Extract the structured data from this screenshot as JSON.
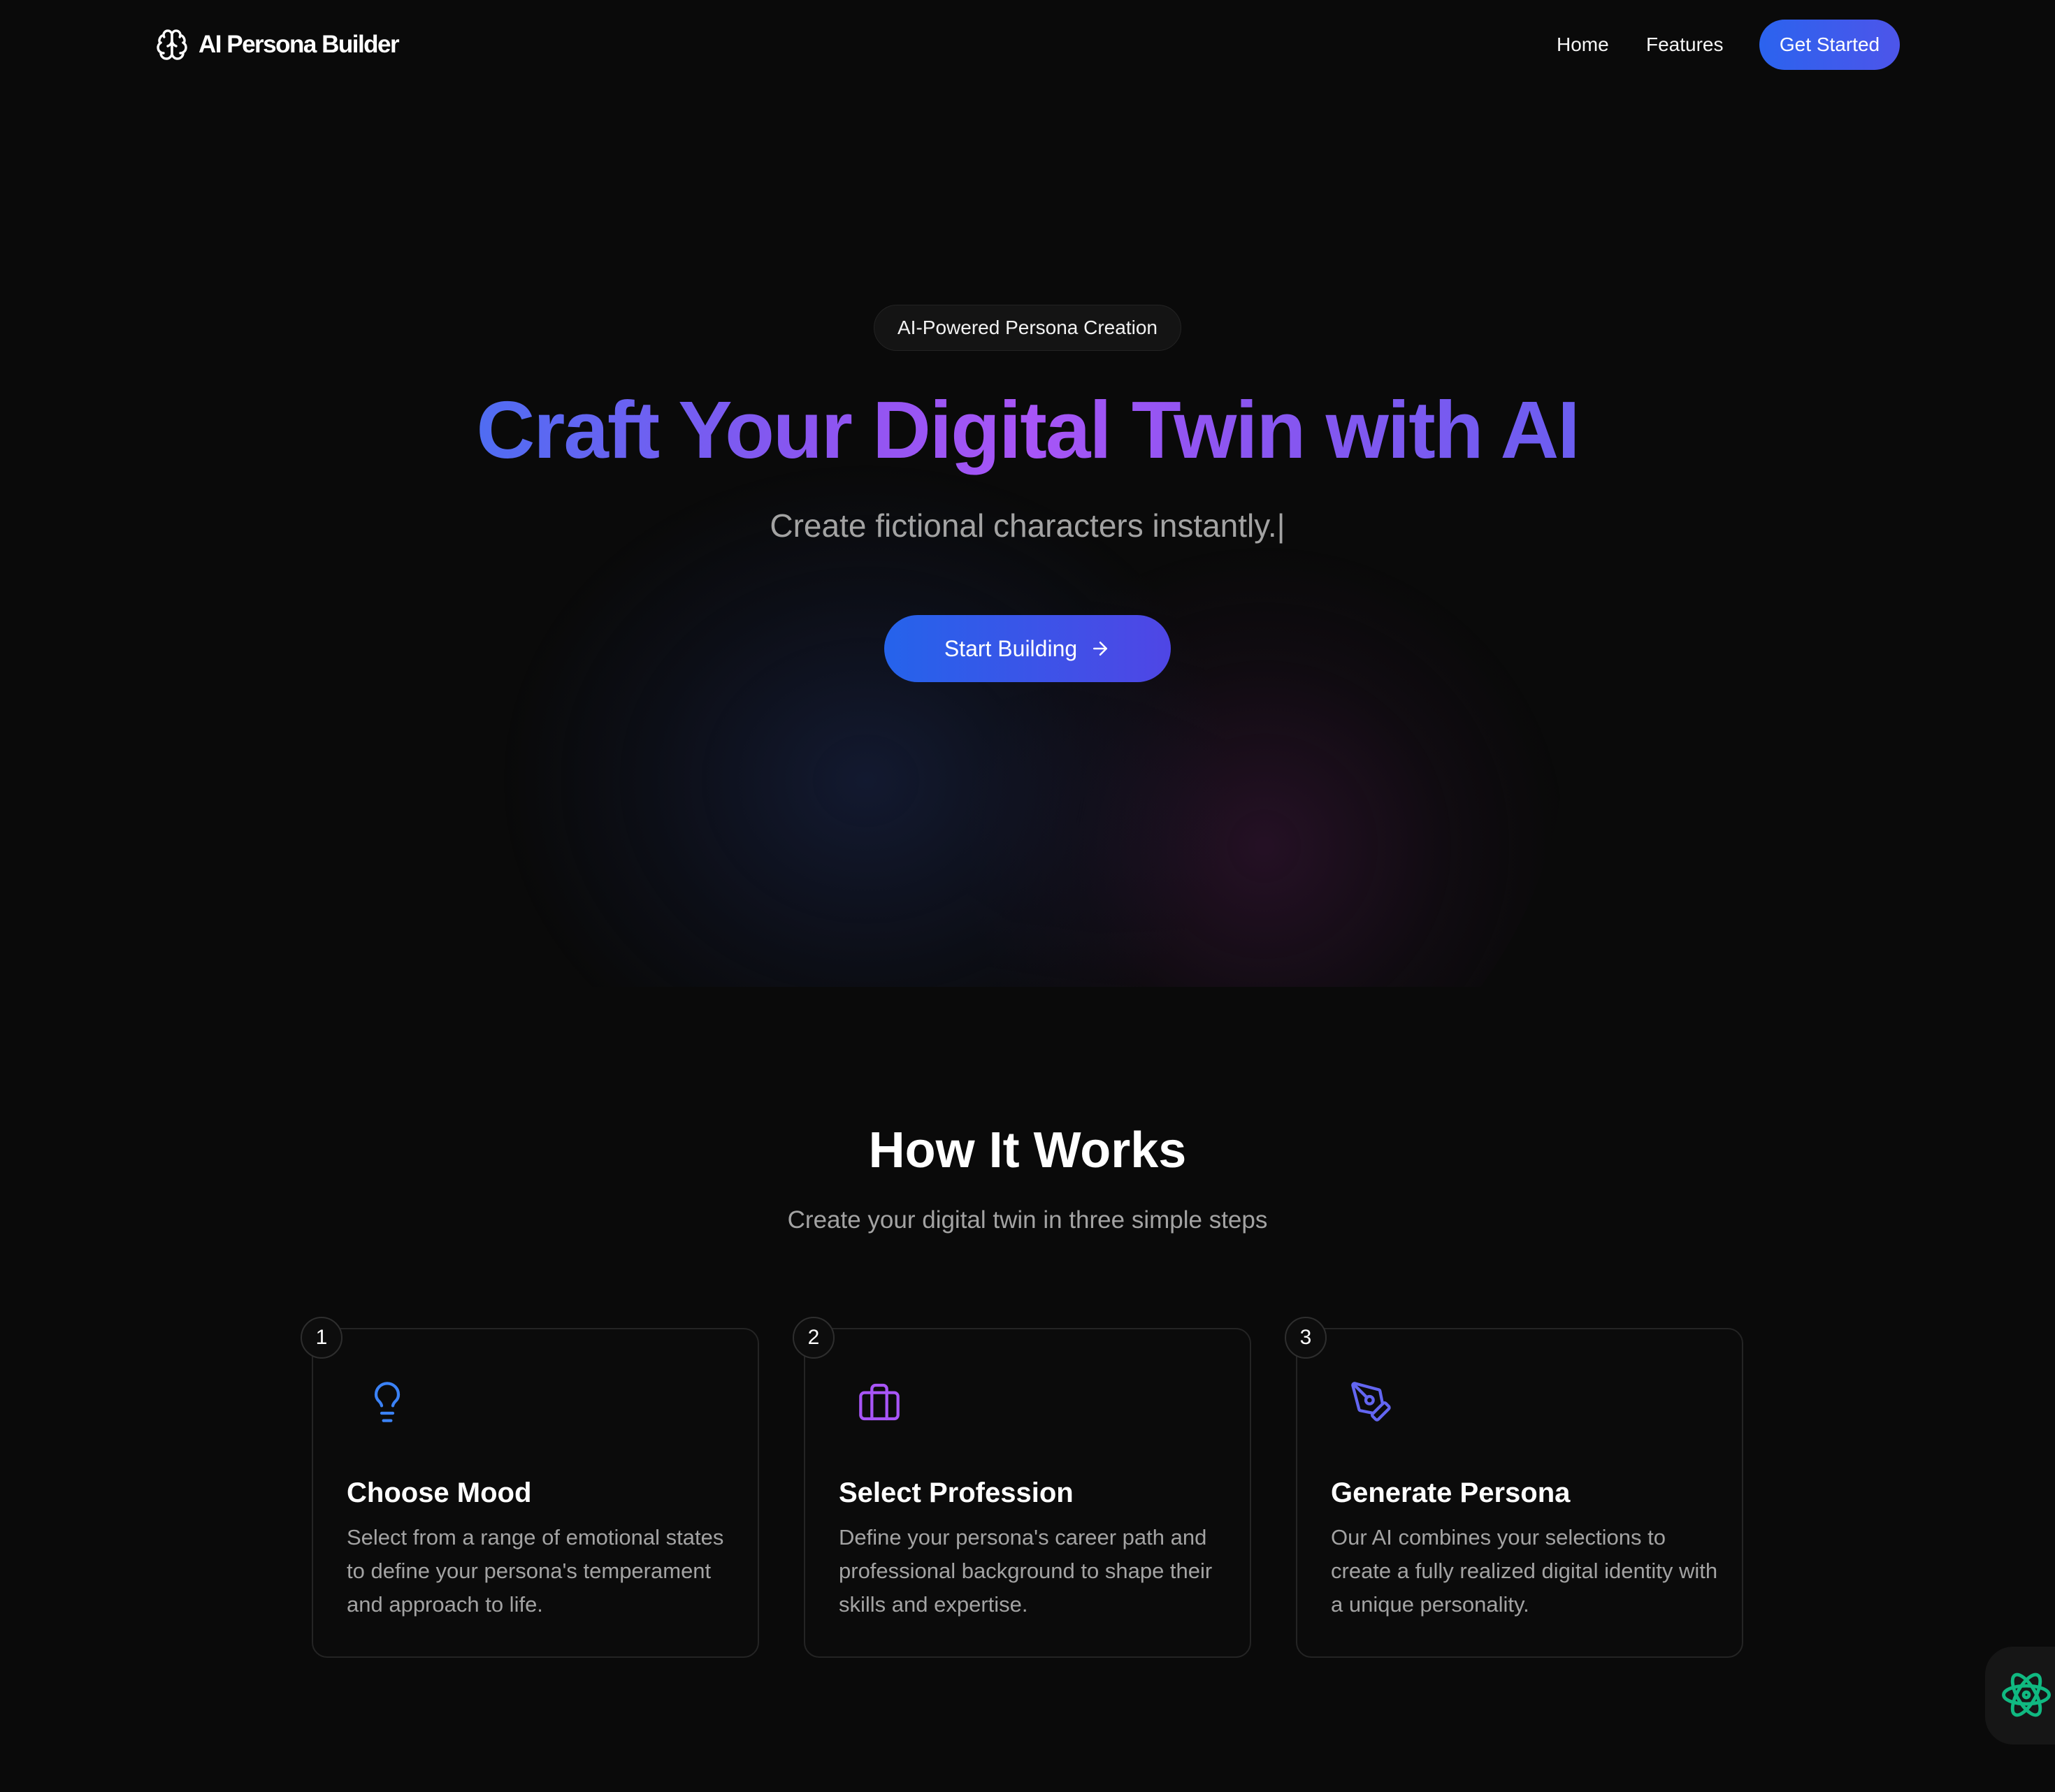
{
  "nav": {
    "brand": "AI Persona Builder",
    "brand_icon": "brain-icon",
    "links": [
      {
        "label": "Home"
      },
      {
        "label": "Features"
      }
    ],
    "cta_label": "Get Started"
  },
  "hero": {
    "badge": "AI-Powered Persona Creation",
    "title": "Craft Your Digital Twin with AI",
    "subtitle": "Create fictional characters instantly.",
    "typing_cursor": "|",
    "cta_label": "Start Building",
    "cta_icon": "arrow-right-icon"
  },
  "how_it_works": {
    "title": "How It Works",
    "subtitle": "Create your digital twin in three simple steps",
    "steps": [
      {
        "number": "1",
        "icon": "lightbulb-icon",
        "title": "Choose Mood",
        "description": "Select from a range of emotional states to define your persona's temperament and approach to life."
      },
      {
        "number": "2",
        "icon": "briefcase-icon",
        "title": "Select Profession",
        "description": "Define your persona's career path and professional background to shape their skills and expertise."
      },
      {
        "number": "3",
        "icon": "pen-tool-icon",
        "title": "Generate Persona",
        "description": "Our AI combines your selections to create a fully realized digital identity with a unique personality."
      }
    ]
  },
  "floating_widget": {
    "icon": "react-atom-icon"
  },
  "colors": {
    "background": "#0a0a0a",
    "accent_blue": "#2563eb",
    "accent_indigo": "#4f46e5",
    "accent_purple": "#a855f7",
    "muted_text": "#a3a3a3",
    "widget_icon": "#10b981"
  }
}
